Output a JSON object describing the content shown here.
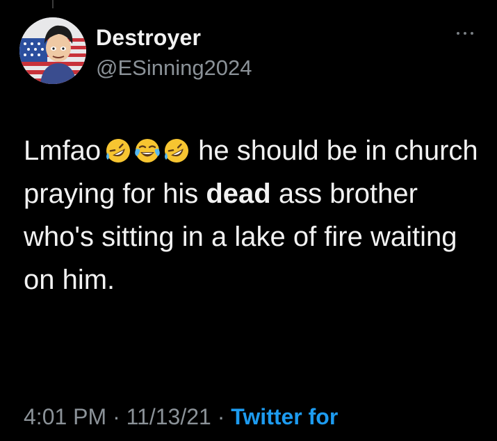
{
  "tweet": {
    "display_name": "Destroyer",
    "handle": "@ESinning2024",
    "text_part1": "Lmfao",
    "text_part2": "he should be in church praying for his",
    "text_bold": "dead",
    "text_part3": "ass brother who's sitting in a lake of fire waiting on him.",
    "emojis": [
      "rolling-on-floor-laughing",
      "face-with-tears-of-joy",
      "rolling-on-floor-laughing"
    ],
    "time": "4:01 PM",
    "separator": "·",
    "date": "11/13/21",
    "source": "Twitter for"
  },
  "colors": {
    "background": "#000000",
    "primary_text": "#f2f2f2",
    "secondary_text": "#8b9298",
    "link": "#1d9bf0"
  }
}
